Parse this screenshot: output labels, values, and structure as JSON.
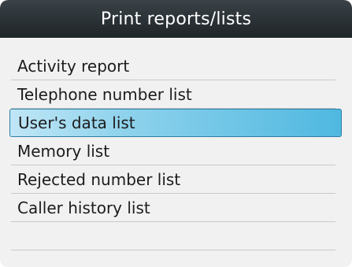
{
  "title": "Print reports/lists",
  "items": [
    {
      "label": "Activity report"
    },
    {
      "label": "Telephone number list"
    },
    {
      "label": "User's data list"
    },
    {
      "label": "Memory list"
    },
    {
      "label": "Rejected number list"
    },
    {
      "label": "Caller history list"
    }
  ],
  "selected_index": 2,
  "colors": {
    "title_bar": "#2a3136",
    "highlight": "#6cc4e8",
    "background": "#f1f1f1"
  }
}
